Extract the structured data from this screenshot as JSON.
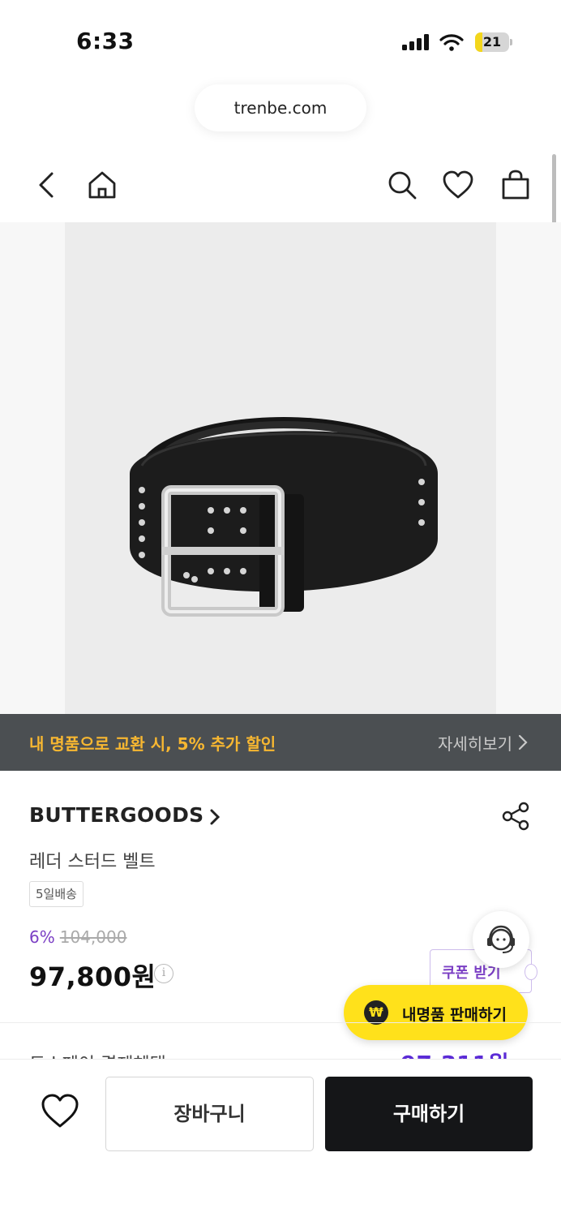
{
  "status_bar": {
    "time": "6:33",
    "battery": "21",
    "battery_level": 0.21
  },
  "browser": {
    "url": "trenbe.com"
  },
  "nav": {
    "back_icon": "chevron-left-icon",
    "home_icon": "home-icon",
    "search_icon": "search-icon",
    "wishlist_icon": "heart-icon",
    "cart_icon": "shopping-bag-icon"
  },
  "promo": {
    "text": "내 명품으로 교환 시, 5% 추가 할인",
    "link": "자세히보기"
  },
  "product": {
    "brand": "BUTTERGOODS",
    "name": "레더 스터드 벨트",
    "delivery": "5일배송",
    "discount": "6%",
    "original_price": "104,000",
    "final_price": "97,800원"
  },
  "coupon": {
    "label": "쿠폰 받기"
  },
  "sell": {
    "label": "내명품 판매하기"
  },
  "bottom": {
    "cart_label": "장바구니",
    "buy_label": "구매하기"
  },
  "colors": {
    "accent_purple": "#7b3fc4",
    "promo_yellow": "#f7b731",
    "fab_yellow": "#ffe11b",
    "buy_black": "#151618",
    "banner_gray": "#4b4f52"
  }
}
